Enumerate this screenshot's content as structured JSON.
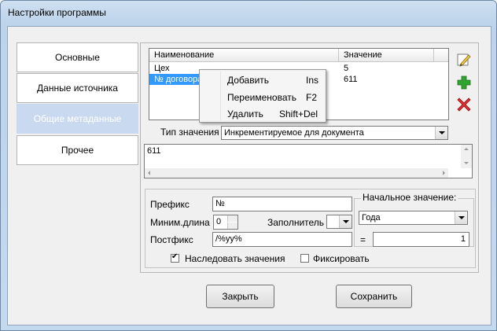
{
  "window": {
    "title": "Настройки программы"
  },
  "nav": [
    {
      "label": "Основные"
    },
    {
      "label": "Данные источника"
    },
    {
      "label": "Общие метаданные"
    },
    {
      "label": "Прочее"
    }
  ],
  "grid": {
    "columns": [
      "Наименование",
      "Значение"
    ],
    "rows": [
      {
        "name": "Цех",
        "value": "5"
      },
      {
        "name": "№ договора",
        "value": "611"
      }
    ]
  },
  "context_menu": [
    {
      "label": "Добавить",
      "shortcut": "Ins"
    },
    {
      "label": "Переименовать",
      "shortcut": "F2"
    },
    {
      "label": "Удалить",
      "shortcut": "Shift+Del"
    }
  ],
  "value_type": {
    "label": "Тип значения",
    "selected": "Инкрементируемое для документа"
  },
  "value_text": "611",
  "form": {
    "prefix_label": "Префикс",
    "prefix_value": "№",
    "minlen_label": "Миним.длина",
    "minlen_value": "0",
    "filler_label": "Заполнитель",
    "filler_value": "",
    "postfix_label": "Постфикс",
    "postfix_value": "/%yy%",
    "inherit_label": "Наследовать значения",
    "fix_label": "Фиксировать",
    "initial_title": "Начальное значение:",
    "initial_period": "Года",
    "eq_label": "=",
    "initial_value": "1"
  },
  "buttons": {
    "close": "Закрыть",
    "save": "Сохранить"
  },
  "colors": {
    "accent": "#3399ff"
  }
}
